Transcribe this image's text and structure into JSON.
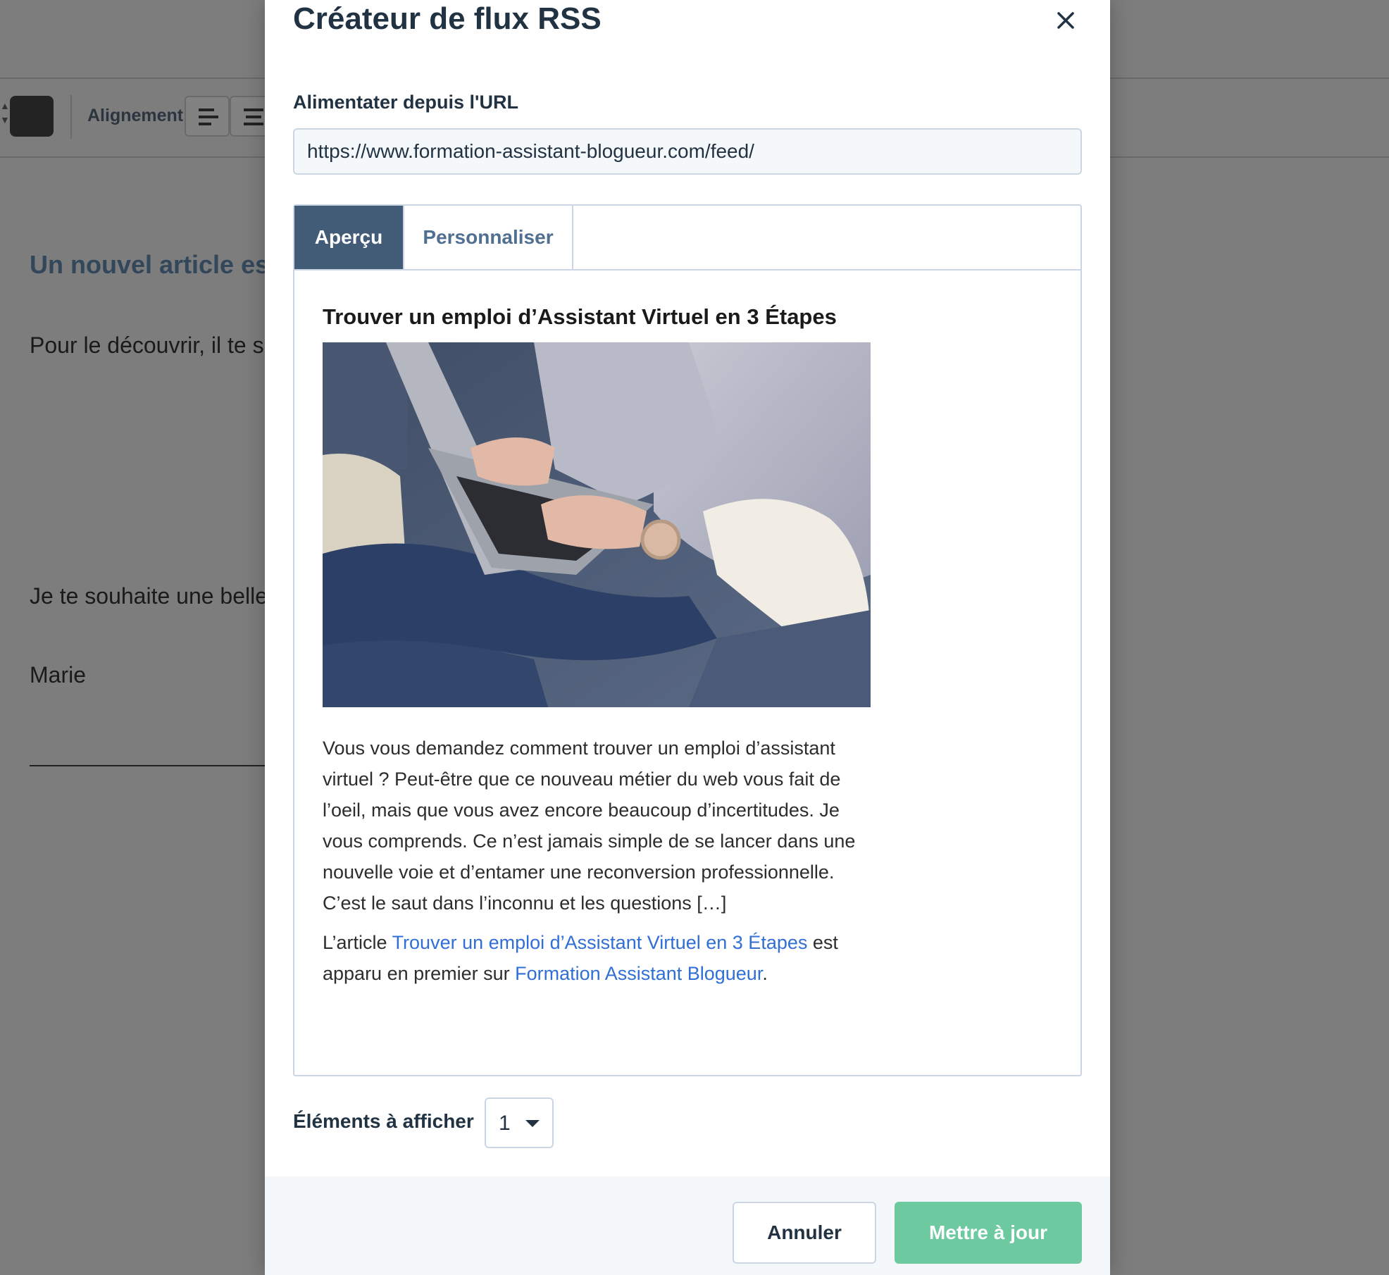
{
  "editor": {
    "align_label": "Alignement",
    "heading": "Un nouvel article est",
    "line1": "Pour le découvrir, il te su",
    "line2": "Je te souhaite une belle",
    "signature": "Marie"
  },
  "modal": {
    "title": "Créateur de flux RSS",
    "url_label": "Alimentater depuis l'URL",
    "url_value": "https://www.formation-assistant-blogueur.com/feed/",
    "tabs": [
      {
        "label": "Aperçu",
        "active": true
      },
      {
        "label": "Personnaliser",
        "active": false
      }
    ],
    "preview": {
      "post_title": "Trouver un emploi d’Assistant Virtuel en 3 Étapes",
      "image_icon": "laptop-photo",
      "excerpt": "Vous vous demandez comment trouver un emploi d’assistant virtuel ? Peut-être que ce nouveau métier du web vous fait de l’oeil, mais que vous avez encore beaucoup d’incertitudes. Je vous comprends. Ce n’est jamais simple de se lancer dans une nouvelle voie et d’entamer une reconversion professionnelle. C’est le saut dans l’inconnu et les questions […]",
      "footer_prefix": "L’article ",
      "footer_link1": "Trouver un emploi d’Assistant Virtuel en 3 Étapes",
      "footer_middle": " est apparu en premier sur ",
      "footer_link2": "Formation Assistant Blogueur",
      "footer_suffix": "."
    },
    "items_label": "Éléments à afficher",
    "items_value": "1",
    "cancel_label": "Annuler",
    "update_label": "Mettre à jour"
  },
  "colors": {
    "accent_dark": "#425b76",
    "update_button": "#6cc9a0",
    "link": "#2f6fd6"
  }
}
